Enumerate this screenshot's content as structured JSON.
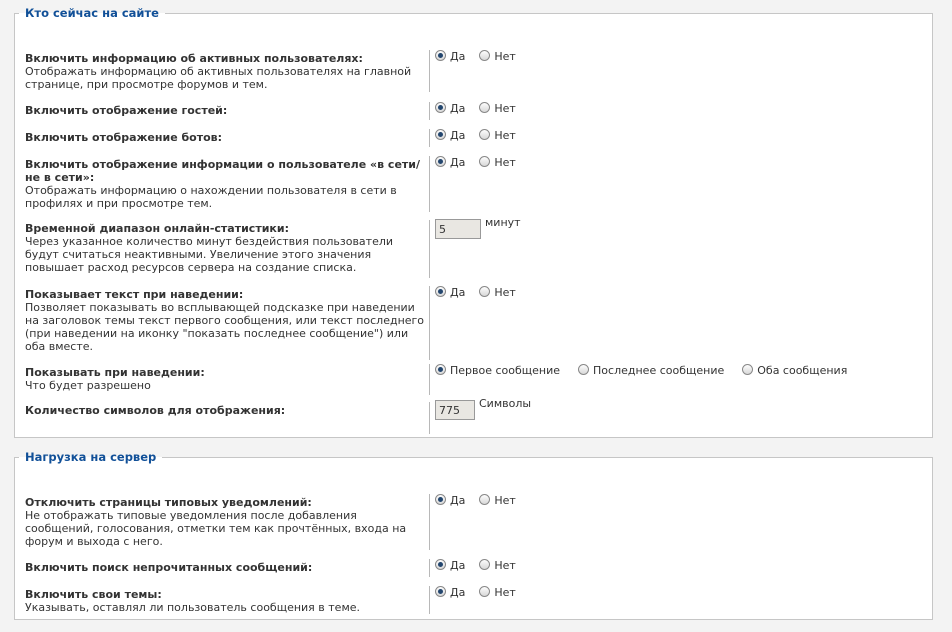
{
  "sections": [
    {
      "title": "Кто сейчас на сайте",
      "rows": [
        {
          "label": "Включить информацию об активных пользователях:",
          "desc": "Отображать информацию об активных пользователях на главной странице, при просмотре форумов и тем.",
          "type": "radio",
          "options": [
            "Да",
            "Нет"
          ],
          "selected": 0
        },
        {
          "label": "Включить отображение гостей:",
          "desc": "",
          "type": "radio",
          "options": [
            "Да",
            "Нет"
          ],
          "selected": 0
        },
        {
          "label": "Включить отображение ботов:",
          "desc": "",
          "type": "radio",
          "options": [
            "Да",
            "Нет"
          ],
          "selected": 0
        },
        {
          "label": "Включить отображение информации о пользователе «в сети/не в сети»:",
          "desc": "Отображать информацию о нахождении пользователя в сети в профилях и при просмотре тем.",
          "type": "radio",
          "options": [
            "Да",
            "Нет"
          ],
          "selected": 0
        },
        {
          "label": "Временной диапазон онлайн-статистики:",
          "desc": "Через указанное количество минут бездействия пользователи будут считаться неактивными. Увеличение этого значения повышает расход ресурсов сервера на создание списка.",
          "type": "number",
          "value": "5",
          "unit": "минут"
        },
        {
          "label": "Показывает текст при наведении:",
          "desc": "Позволяет показывать во всплывающей подсказке при наведении на заголовок темы текст первого сообщения, или текст последнего (при наведении на иконку \"показать последнее сообщение\") или оба вместе.",
          "type": "radio",
          "options": [
            "Да",
            "Нет"
          ],
          "selected": 0
        },
        {
          "label": "Показывать при наведении:",
          "desc": "Что будет разрешено",
          "type": "radio",
          "options": [
            "Первое сообщение",
            "Последнее сообщение",
            "Оба сообщения"
          ],
          "selected": 0
        },
        {
          "label": "Количество символов для отображения:",
          "desc": "",
          "type": "number",
          "value": "775",
          "unit": "Символы"
        }
      ]
    },
    {
      "title": "Нагрузка на сервер",
      "rows": [
        {
          "label": "Отключить страницы типовых уведомлений:",
          "desc": "Не отображать типовые уведомления после добавления сообщений, голосования, отметки тем как прочтённых, входа на форум и выхода с него.",
          "type": "radio",
          "options": [
            "Да",
            "Нет"
          ],
          "selected": 0
        },
        {
          "label": "Включить поиск непрочитанных сообщений:",
          "desc": "",
          "type": "radio",
          "options": [
            "Да",
            "Нет"
          ],
          "selected": 0
        },
        {
          "label": "Включить свои темы:",
          "desc": "Указывать, оставлял ли пользователь сообщения в теме.",
          "type": "radio",
          "options": [
            "Да",
            "Нет"
          ],
          "selected": 0
        }
      ]
    }
  ]
}
